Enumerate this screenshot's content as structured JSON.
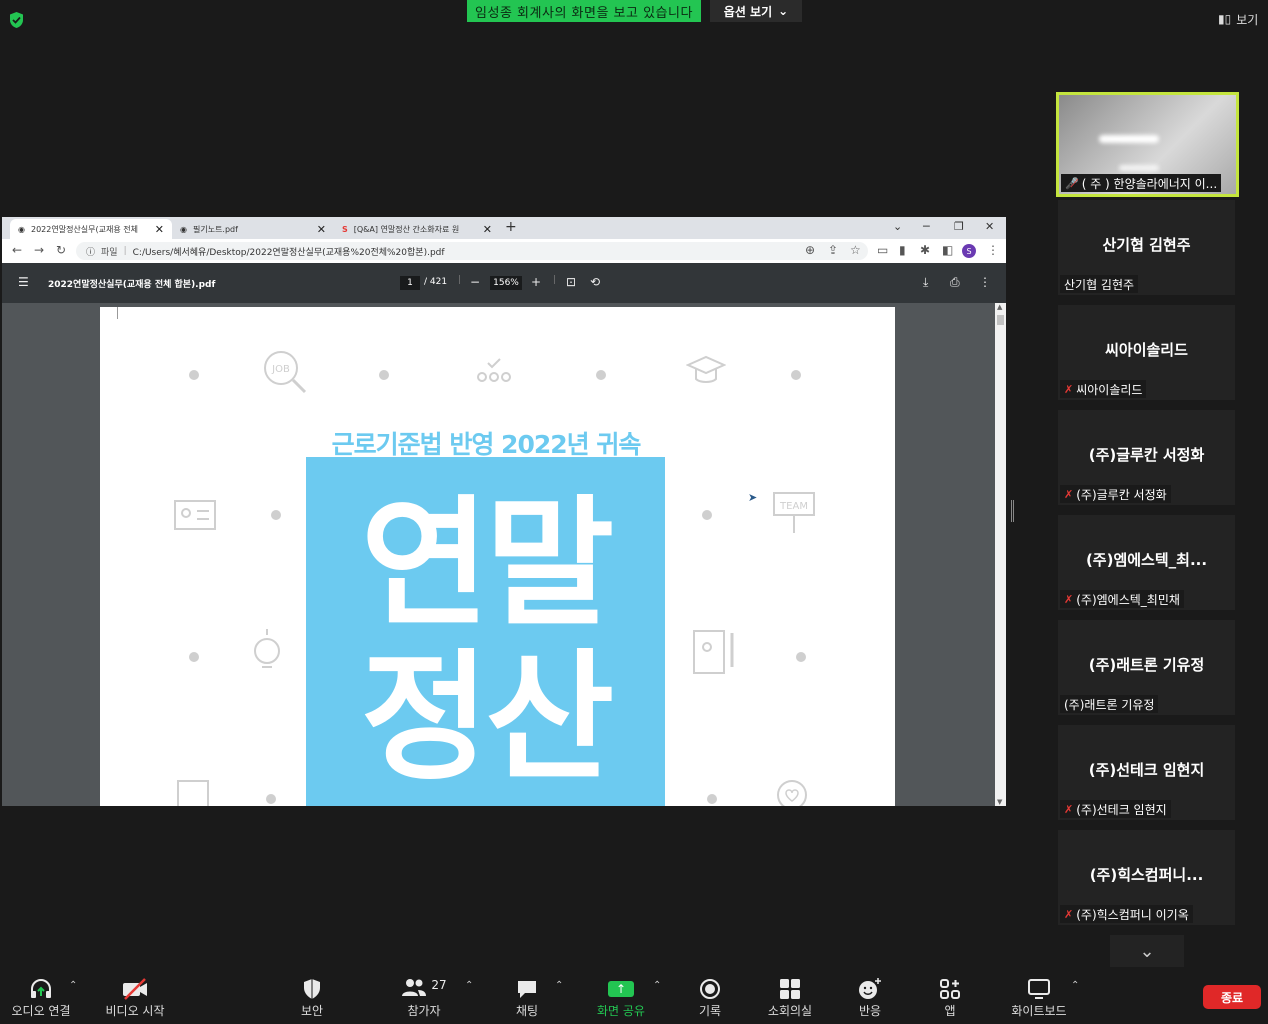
{
  "top": {
    "share_banner": "임성종 회계사의 화면을 보고 있습니다",
    "view_options": "옵션 보기",
    "view_button": "보기"
  },
  "browser": {
    "tabs": [
      {
        "label": "2022연말정산실무(교재용 전체"
      },
      {
        "label": "필기노트.pdf"
      },
      {
        "label": "[Q&A] 연말정산 간소화자료 원"
      }
    ],
    "address_label": "파일",
    "url": "C:/Users/혜서혜유/Desktop/2022연말정산실무(교재용%20전체%20합본).pdf",
    "profile_initial": "S",
    "pdf_title": "2022연말정산실무(교재용 전체 합본).pdf",
    "page_current": "1",
    "page_total": "/ 421",
    "zoom": "156%"
  },
  "pdf_cover": {
    "subtitle": "근로기준법 반영 2022년 귀속",
    "title_line1": "연말",
    "title_line2": "정산",
    "icon_job": "JOB",
    "icon_team": "TEAM"
  },
  "participants": [
    {
      "display": "",
      "name": "( 주 ) 한양솔라에너지 이...",
      "muted": true
    },
    {
      "display": "산기협 김현주",
      "name": "산기협 김현주",
      "muted": false
    },
    {
      "display": "씨아이솔리드",
      "name": "씨아이솔리드",
      "muted": true
    },
    {
      "display": "(주)글루칸 서정화",
      "name": "(주)글루칸 서정화",
      "muted": true
    },
    {
      "display": "(주)엠에스텍_최...",
      "name": "(주)엠에스텍_최민채",
      "muted": true
    },
    {
      "display": "(주)래트론 기유정",
      "name": "(주)래트론 기유정",
      "muted": false
    },
    {
      "display": "(주)선테크 임현지",
      "name": "(주)선테크 임현지",
      "muted": true
    },
    {
      "display": "(주)힉스컴퍼니...",
      "name": "(주)힉스컴퍼니 이기옥",
      "muted": true
    }
  ],
  "toolbar": {
    "audio": "오디오 연결",
    "video": "비디오 시작",
    "security": "보안",
    "participants": "참가자",
    "participant_count": "27",
    "chat": "채팅",
    "share": "화면 공유",
    "record": "기록",
    "breakout": "소회의실",
    "reactions": "반응",
    "apps": "앱",
    "whiteboard": "화이트보드",
    "end": "종료"
  },
  "colors": {
    "share_green": "#23c552",
    "active_speaker": "#c4e53e",
    "end_red": "#e02828",
    "cover_blue": "#6ccaf0"
  }
}
